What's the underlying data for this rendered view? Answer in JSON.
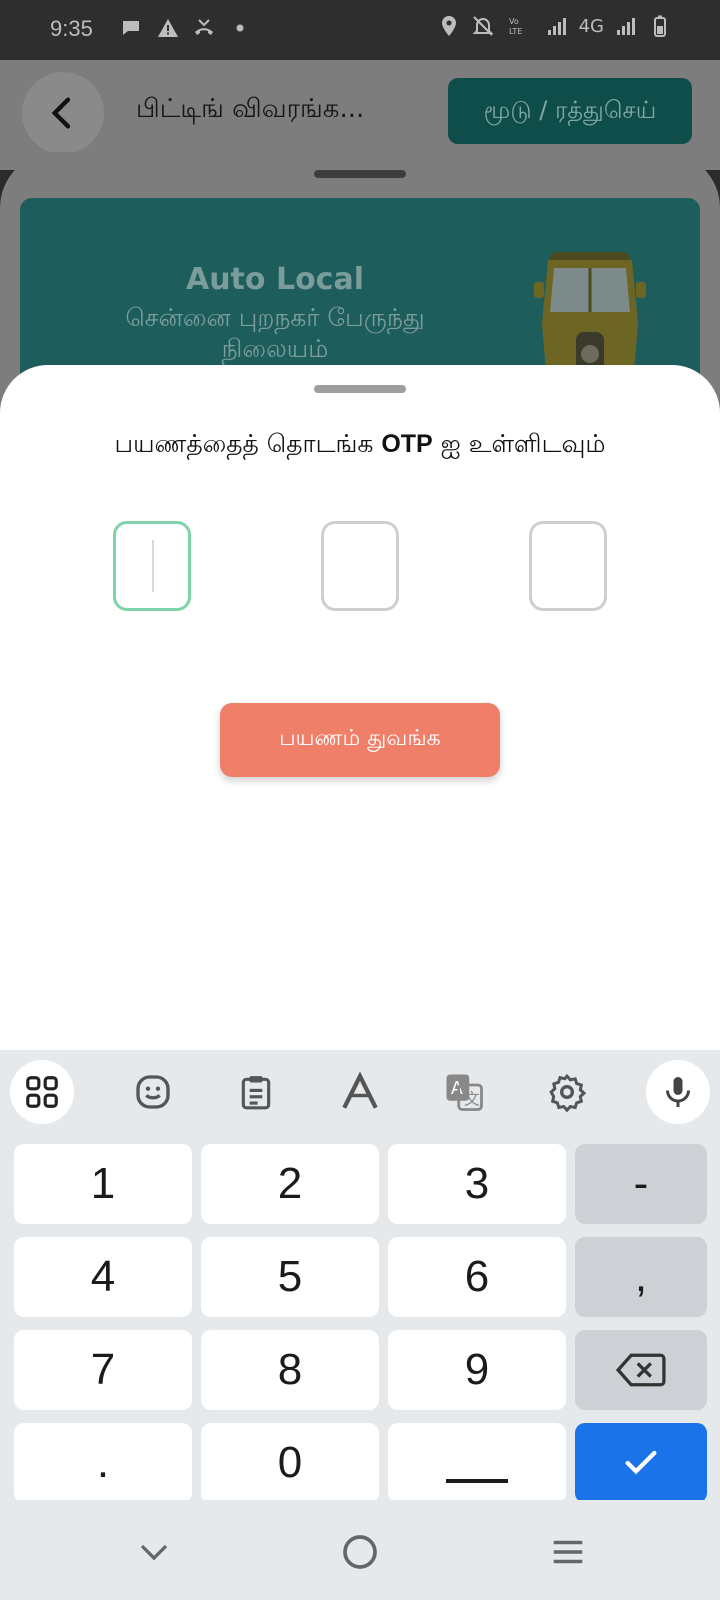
{
  "status_bar": {
    "time": "9:35",
    "network_label": "4G",
    "icons": [
      "chat-icon",
      "warning-icon",
      "missed-call-icon",
      "dot-icon",
      "location-icon",
      "mute-icon",
      "volte-icon",
      "signal-icon",
      "battery-icon"
    ]
  },
  "header": {
    "title": "பிட்டிங் விவரங்க...",
    "cancel_label": "மூடு / ரத்துசெய்"
  },
  "ride_card": {
    "type": "Auto Local",
    "place": "சென்னை புறநகர் பேருந்து நிலையம்"
  },
  "otp_sheet": {
    "title_before": "பயணத்தைத் தொடங்க ",
    "title_bold": "OTP",
    "title_after": " ஐ உள்ளிடவும்",
    "boxes": [
      "",
      "",
      ""
    ],
    "start_label": "பயணம் துவங்க"
  },
  "keyboard": {
    "toolbar": [
      "apps-icon",
      "sticker-icon",
      "clipboard-icon",
      "text-style-icon",
      "translate-icon",
      "settings-icon",
      "mic-icon"
    ],
    "rows": [
      [
        "1",
        "2",
        "3",
        "-"
      ],
      [
        "4",
        "5",
        "6",
        ","
      ],
      [
        "7",
        "8",
        "9",
        "backspace"
      ],
      [
        ".",
        "0",
        "space",
        "enter"
      ]
    ],
    "labels": {
      "k1": "1",
      "k2": "2",
      "k3": "3",
      "dash": "-",
      "k4": "4",
      "k5": "5",
      "k6": "6",
      "comma": ",",
      "k7": "7",
      "k8": "8",
      "k9": "9",
      "dot": ".",
      "k0": "0"
    }
  },
  "nav": [
    "hide-keyboard-icon",
    "home-icon",
    "menu-icon"
  ],
  "colors": {
    "accent_green": "#7fd3a8",
    "start_button": "#ef7f69",
    "enter_key": "#1a73e8",
    "card_teal": "#1d5e5c"
  }
}
